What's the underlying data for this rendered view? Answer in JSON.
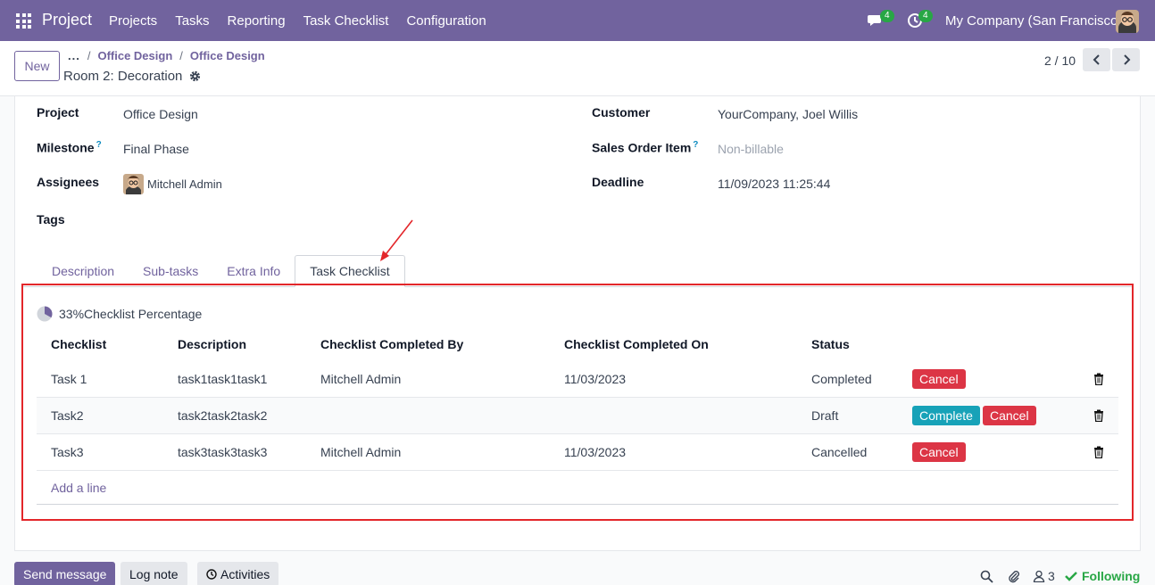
{
  "navbar": {
    "brand": "Project",
    "menu": [
      "Projects",
      "Tasks",
      "Reporting",
      "Task Checklist",
      "Configuration"
    ],
    "chat_badge": "4",
    "activity_badge": "4",
    "company": "My Company (San Francisco)"
  },
  "control": {
    "new_label": "New",
    "breadcrumb_dots": "...",
    "breadcrumb_sep": "/",
    "breadcrumb": [
      "Office Design",
      "Office Design"
    ],
    "record_title": "Room 2: Decoration",
    "pager": "2 / 10"
  },
  "form": {
    "project_label": "Project",
    "project_value": "Office Design",
    "milestone_label": "Milestone",
    "milestone_help": "?",
    "milestone_value": "Final Phase",
    "assignees_label": "Assignees",
    "assignees_value": "Mitchell Admin",
    "tags_label": "Tags",
    "customer_label": "Customer",
    "customer_value": "YourCompany, Joel Willis",
    "soi_label": "Sales Order Item",
    "soi_help": "?",
    "soi_value": "Non-billable",
    "deadline_label": "Deadline",
    "deadline_value": "11/09/2023 11:25:44"
  },
  "tabs": [
    "Description",
    "Sub-tasks",
    "Extra Info",
    "Task Checklist"
  ],
  "checklist": {
    "percentage_text": "33%Checklist Percentage",
    "percentage": 33,
    "columns": [
      "Checklist",
      "Description",
      "Checklist Completed By",
      "Checklist Completed On",
      "Status"
    ],
    "rows": [
      {
        "name": "Task 1",
        "description": "task1task1task1",
        "completed_by": "Mitchell Admin",
        "completed_on": "11/03/2023",
        "status": "Completed",
        "buttons": [
          "Cancel"
        ]
      },
      {
        "name": "Task2",
        "description": "task2task2task2",
        "completed_by": "",
        "completed_on": "",
        "status": "Draft",
        "buttons": [
          "Complete",
          "Cancel"
        ]
      },
      {
        "name": "Task3",
        "description": "task3task3task3",
        "completed_by": "Mitchell Admin",
        "completed_on": "11/03/2023",
        "status": "Cancelled",
        "buttons": [
          "Cancel"
        ]
      }
    ],
    "add_line": "Add a line"
  },
  "chatter": {
    "send_message": "Send message",
    "log_note": "Log note",
    "activities": "Activities",
    "followers_count": "3",
    "following": "Following"
  },
  "colors": {
    "brand": "#71639e",
    "cancel": "#dc3545",
    "complete": "#17a2b8",
    "highlight": "#e3262a"
  }
}
